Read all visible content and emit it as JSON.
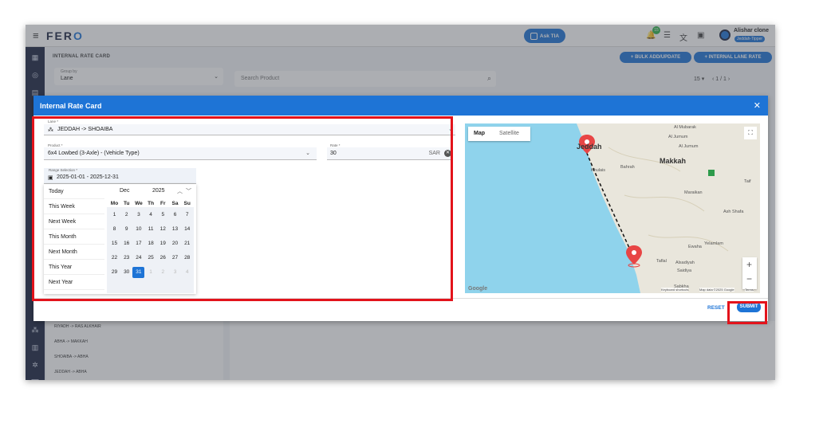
{
  "app": {
    "logo": "FER",
    "logo_accent": "O",
    "ask_label": "Ask TIA",
    "notif_count": "15",
    "user_name": "Alishar clone",
    "user_org": "Jeddah-Tipper"
  },
  "background": {
    "page_title": "INTERNAL RATE CARD",
    "bulk_button": "+ BULK ADD/UPDATE",
    "lane_rate_button": "+ INTERNAL LANE RATE",
    "group_by_label": "Group by",
    "group_by_value": "Lane",
    "search_placeholder": "Search Product",
    "page_size": "15",
    "page_count": "1 / 1",
    "list": [
      "RIYADH -> RAS ALKHAIR",
      "ABHA -> MAKKAH",
      "SHOAIBA -> ABHA",
      "JEDDAH -> ABHA"
    ]
  },
  "modal": {
    "title": "Internal Rate Card",
    "lane_label": "Lane *",
    "lane_value": "JEDDAH -> SHOAIBA",
    "product_label": "Product *",
    "product_value": "6x4 Lowbed (3-Axle) - (Vehicle Type)",
    "rate_label": "Rate *",
    "rate_value": "30",
    "currency": "SAR",
    "range_label": "Range Selection *",
    "range_value": "2025-01-01 - 2025-12-31",
    "presets": [
      "Today",
      "This Week",
      "Next Week",
      "This Month",
      "Next Month",
      "This Year",
      "Next Year"
    ],
    "calendar": {
      "month": "Dec",
      "year": "2025",
      "weekdays": [
        "Mo",
        "Tu",
        "We",
        "Th",
        "Fr",
        "Sa",
        "Su"
      ],
      "weeks": [
        [
          "1",
          "2",
          "3",
          "4",
          "5",
          "6",
          "7"
        ],
        [
          "8",
          "9",
          "10",
          "11",
          "12",
          "13",
          "14"
        ],
        [
          "15",
          "16",
          "17",
          "18",
          "19",
          "20",
          "21"
        ],
        [
          "22",
          "23",
          "24",
          "25",
          "26",
          "27",
          "28"
        ],
        [
          "29",
          "30",
          "31",
          "1",
          "2",
          "3",
          "4"
        ]
      ],
      "selected": "31"
    },
    "map": {
      "tab_map": "Map",
      "tab_satellite": "Satellite",
      "origin": "Jeddah",
      "city2": "Makkah",
      "labels": [
        "Al Mubarak",
        "Al Jumum",
        "Bahrah",
        "Khulais",
        "Al Jumum",
        "Taif",
        "Maraikan",
        "Ash Shafa",
        "Yelamlam",
        "Ewaha",
        "Taflal",
        "Alsadiyah",
        "Saidiya",
        "Sabkha"
      ],
      "footer_kb": "Keyboard shortcuts",
      "footer_data": "Map data ©2025 Google",
      "footer_terms": "Terms",
      "google": "Google"
    },
    "reset_label": "RESET",
    "submit_label": "SUBMIT"
  },
  "colors": {
    "primary": "#1e74d6",
    "sidebar": "#1a2340",
    "highlight": "#e3131b"
  }
}
